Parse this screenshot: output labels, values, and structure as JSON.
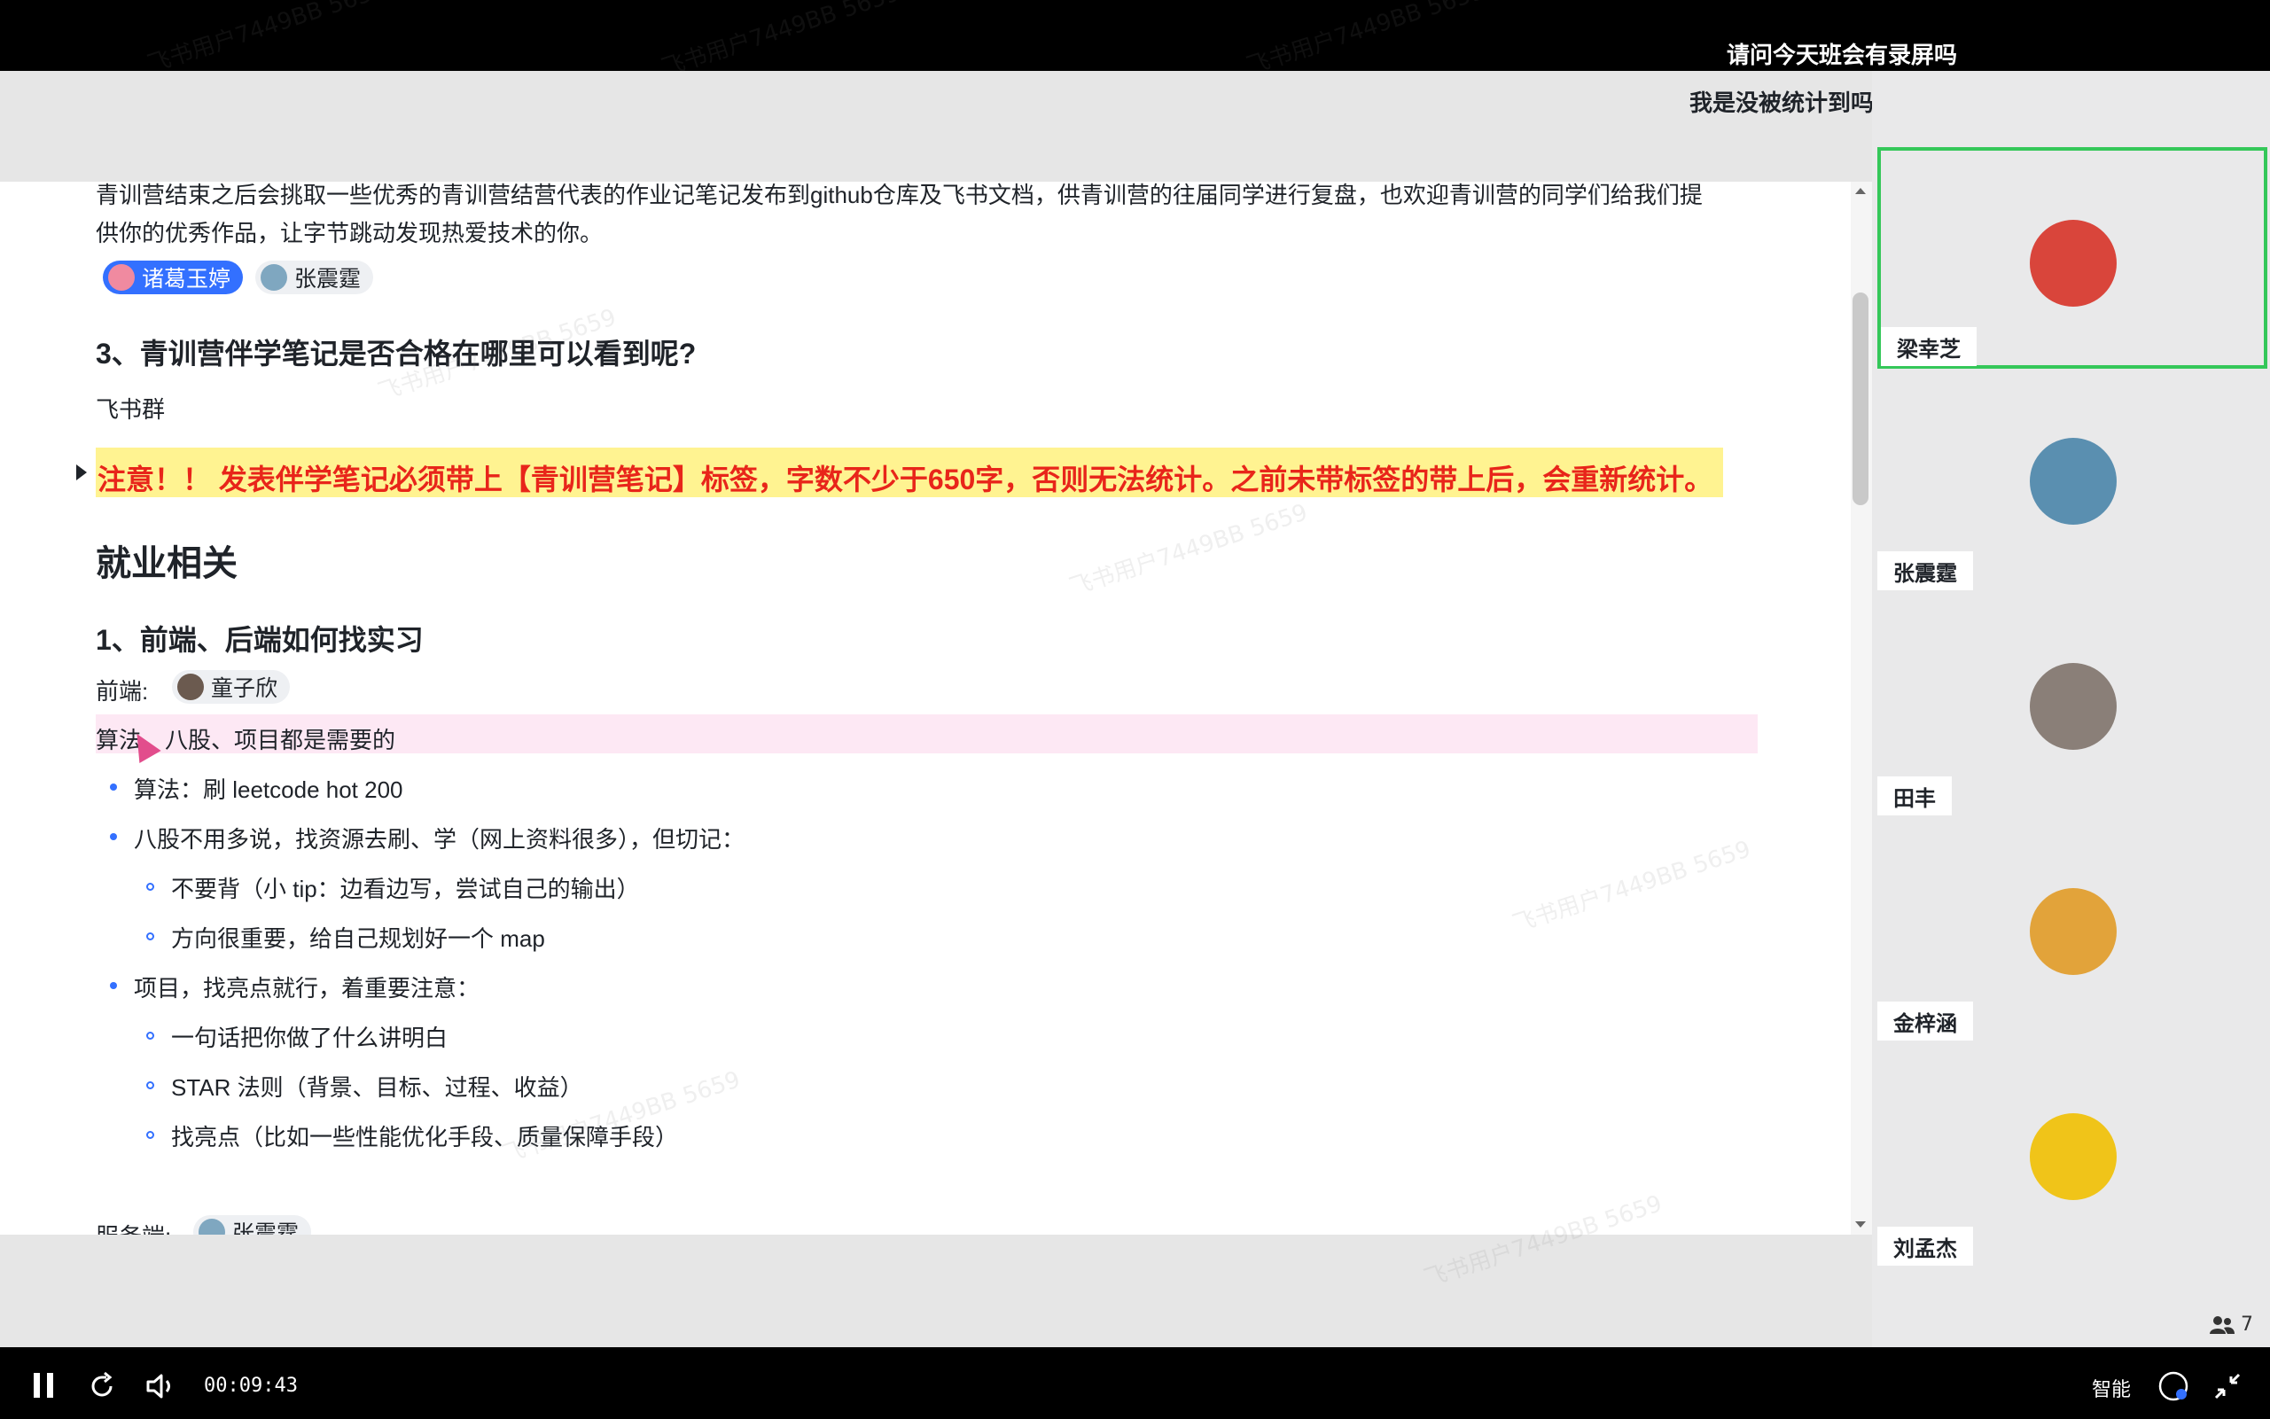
{
  "top_messages": {
    "line1": "请问今天班会有录屏吗",
    "line2": "我是没被统计到吗？",
    "line2_emoji": "😭"
  },
  "doc": {
    "intro_line1": "青训营结束之后会挑取一些优秀的青训营结营代表的作业记笔记发布到github仓库及飞书文档，供青训营的往届同学进行复盘，也欢迎青训营的同学们给我们提",
    "intro_line2": "供你的优秀作品，让字节跳动发现热爱技术的你。",
    "mention1": "诸葛玉婷",
    "mention2": "张震霆",
    "q3_title": "3、青训营伴学笔记是否合格在哪里可以看到呢?",
    "q3_answer": "飞书群",
    "warning": "注意！！ 发表伴学笔记必须带上【青训营笔记】标签，字数不少于650字，否则无法统计。之前未带标签的带上后，会重新统计。",
    "section_title": "就业相关",
    "sub1_title": "1、前端、后端如何找实习",
    "frontend_label": "前端:",
    "frontend_mention": "童子欣",
    "need_line": "算法、八股、项目都是需要的",
    "bullets": [
      "算法：刷 leetcode hot 200",
      "八股不用多说，找资源去刷、学（网上资料很多），但切记：",
      "项目，找亮点就行，着重要注意："
    ],
    "sub_bullets_b2": [
      "不要背（小 tip：边看边写，尝试自己的输出）",
      "方向很重要，给自己规划好一个 map"
    ],
    "sub_bullets_b3": [
      "一句话把你做了什么讲明白",
      "STAR 法则（背景、目标、过程、收益）",
      "找亮点（比如一些性能优化手段、质量保障手段）"
    ],
    "backend_label": "服务端:",
    "backend_mention": "张震霆"
  },
  "participants": [
    {
      "name": "梁幸芝",
      "active": true,
      "color": "#d9453b"
    },
    {
      "name": "张震霆",
      "active": false,
      "color": "#5a8fb0"
    },
    {
      "name": "田丰",
      "active": false,
      "color": "#8a7f78"
    },
    {
      "name": "金梓涵",
      "active": false,
      "color": "#e2a33a"
    },
    {
      "name": "刘孟杰",
      "active": false,
      "color": "#f0c419"
    }
  ],
  "participant_count": "7",
  "controls": {
    "time": "00:09:43",
    "smart_label": "智能"
  },
  "watermark": "飞书用户7449BB 5659"
}
